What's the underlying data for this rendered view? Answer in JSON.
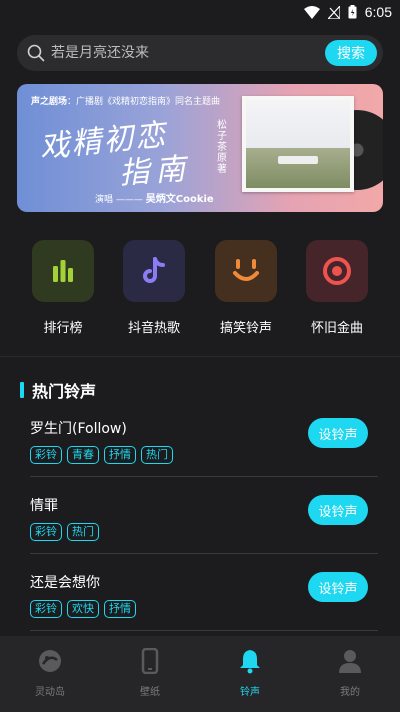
{
  "status_bar": {
    "time": "6:05"
  },
  "search": {
    "placeholder": "若是月亮还没来",
    "button_label": "搜索"
  },
  "banner": {
    "tagline_brand": "声之剧场",
    "tagline_text": "：广播剧《戏精初恋指南》同名主题曲",
    "title_line1": "戏精初恋",
    "title_line2": "指南",
    "author_side": "松子茶原著",
    "credit_prefix": "演唱 ——— ",
    "credit_name": "吴炳文Cookie"
  },
  "categories": [
    {
      "label": "排行榜",
      "icon": "bar-chart-icon",
      "color": "#a3d13a",
      "bg": "#2f3a21"
    },
    {
      "label": "抖音热歌",
      "icon": "tiktok-icon",
      "color": "#8b7cf6",
      "bg": "#2b2a45"
    },
    {
      "label": "搞笑铃声",
      "icon": "smile-icon",
      "color": "#f08a3a",
      "bg": "#45301f"
    },
    {
      "label": "怀旧金曲",
      "icon": "target-icon",
      "color": "#ef5350",
      "bg": "#45252a"
    }
  ],
  "section": {
    "title": "热门铃声"
  },
  "songs": [
    {
      "name": "罗生门(Follow)",
      "tags": [
        "彩铃",
        "青春",
        "抒情",
        "热门"
      ],
      "button": "设铃声"
    },
    {
      "name": "情罪",
      "tags": [
        "彩铃",
        "热门"
      ],
      "button": "设铃声"
    },
    {
      "name": "还是会想你",
      "tags": [
        "彩铃",
        "欢快",
        "抒情"
      ],
      "button": "设铃声"
    }
  ],
  "tabs": [
    {
      "label": "灵动岛",
      "icon": "island-icon",
      "active": false
    },
    {
      "label": "壁纸",
      "icon": "phone-icon",
      "active": false
    },
    {
      "label": "铃声",
      "icon": "bell-icon",
      "active": true
    },
    {
      "label": "我的",
      "icon": "user-icon",
      "active": false
    }
  ],
  "colors": {
    "accent": "#1dd8f0",
    "background": "#1c1c1e",
    "tabbar": "#262628"
  }
}
